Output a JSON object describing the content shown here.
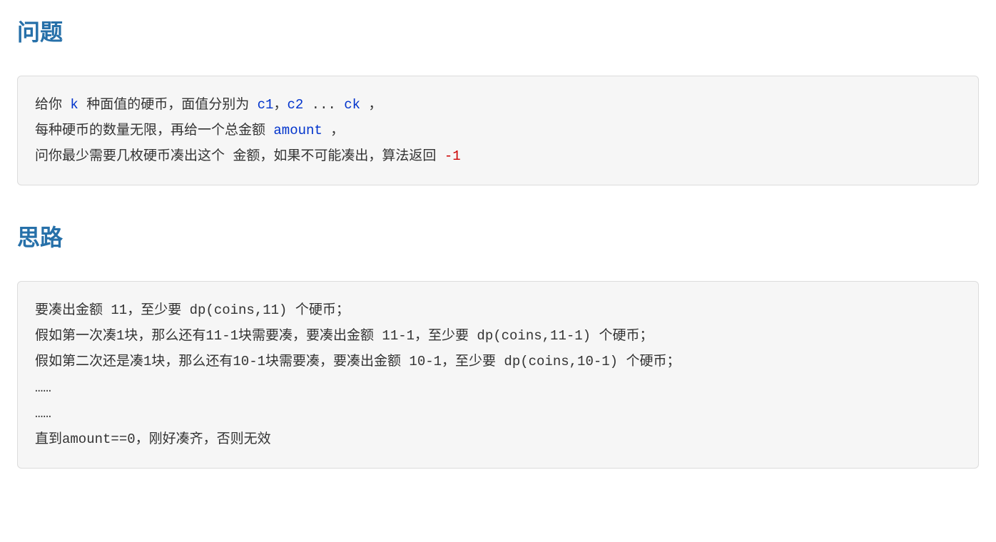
{
  "section1": {
    "heading": "问题",
    "line1_a": "给你 ",
    "line1_k": "k",
    "line1_b": " 种面值的硬币，面值分别为 ",
    "line1_c1": "c1",
    "line1_comma1": "，",
    "line1_c2": "c2",
    "line1_dots": " ... ",
    "line1_ck": "ck",
    "line1_end": " ，",
    "line2_a": "每种硬币的数量无限，再给一个总金额 ",
    "line2_amount": "amount",
    "line2_end": " ，",
    "line3_a": "问你最少需要几枚硬币凑出这个 金额，如果不可能凑出，算法返回 ",
    "line3_minus1": "-1"
  },
  "section2": {
    "heading": "思路",
    "line1": "要凑出金额 11，至少要 dp(coins,11) 个硬币；",
    "line2": "假如第一次凑1块，那么还有11-1块需要凑，要凑出金额 11-1，至少要 dp(coins,11-1) 个硬币；",
    "line3": "假如第二次还是凑1块，那么还有10-1块需要凑，要凑出金额 10-1，至少要 dp(coins,10-1) 个硬币；",
    "line4": "……",
    "line5": "……",
    "line6": "直到amount==0，刚好凑齐，否则无效"
  }
}
